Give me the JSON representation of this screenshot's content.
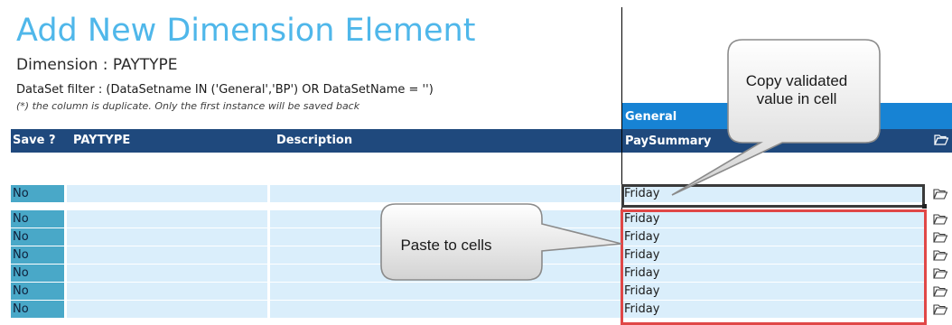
{
  "page": {
    "title": "Add New Dimension Element",
    "subtitle": "Dimension : PAYTYPE",
    "filter": "DataSet filter : (DataSetname IN ('General','BP') OR DataSetName = '')",
    "note": "(*) the column is duplicate. Only the first instance will be saved back"
  },
  "table": {
    "group_label": "General",
    "headers": {
      "save": "Save ?",
      "paytype": "PAYTYPE",
      "description": "Description",
      "paysummary": "PaySummary"
    },
    "rows": [
      {
        "save": "No",
        "paysummary": "Friday"
      },
      {
        "save": "No",
        "paysummary": "Friday"
      },
      {
        "save": "No",
        "paysummary": "Friday"
      },
      {
        "save": "No",
        "paysummary": "Friday"
      },
      {
        "save": "No",
        "paysummary": "Friday"
      },
      {
        "save": "No",
        "paysummary": "Friday"
      },
      {
        "save": "No",
        "paysummary": "Friday"
      }
    ]
  },
  "callouts": {
    "copy": "Copy validated value in cell",
    "paste": "Paste to cells"
  },
  "colors": {
    "title": "#4fb7ea",
    "header_bar": "#1f497d",
    "group_strip": "#1783d4",
    "save_cell": "#49a8c8",
    "row_cell": "#daeefb",
    "copy_highlight": "#3a3a3a",
    "paste_highlight": "#e04747"
  },
  "icons": {
    "header": "folder-open-icon",
    "row": "folder-open-icon"
  }
}
